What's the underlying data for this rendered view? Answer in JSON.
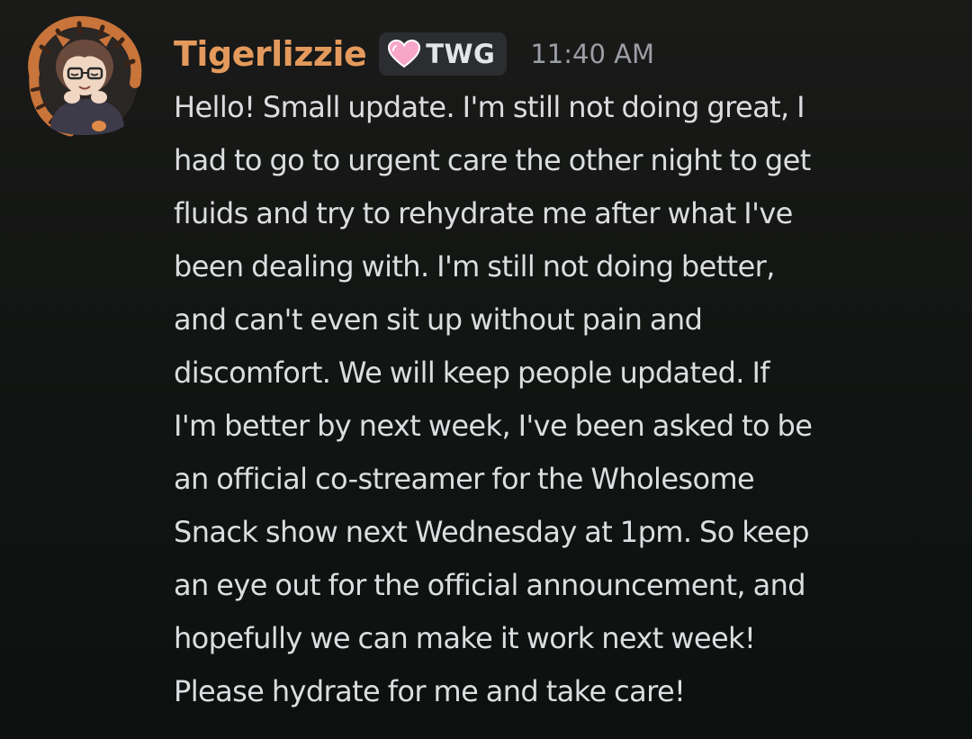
{
  "message": {
    "author": {
      "username": "Tigerlizzie",
      "username_color": "#e49a5c",
      "avatar_icon": "avatar-icon"
    },
    "tag": {
      "icon": "heart-icon",
      "label": "TWG"
    },
    "timestamp": "11:40 AM",
    "lines": [
      "Hello! Small update.  I'm still not doing great,  I",
      "had to go to urgent care the other night to get",
      "fluids and try to rehydrate me after what I've",
      "been dealing with. I'm still not doing better,",
      "and can't even sit up without pain and",
      "discomfort.  We will keep people updated.  If",
      "I'm better by next week,  I've been asked to be",
      "an official co-streamer for the Wholesome",
      "Snack show next Wednesday at 1pm. So keep",
      "an eye out for the official announcement,  and",
      "hopefully we can make it work next week!",
      "Please hydrate for me and take care!"
    ]
  },
  "colors": {
    "background": "#121412",
    "text": "#dcdde0",
    "timestamp": "#9c9ea6",
    "tag_background": "#2c2d31",
    "heart": "#f7a6c9"
  }
}
